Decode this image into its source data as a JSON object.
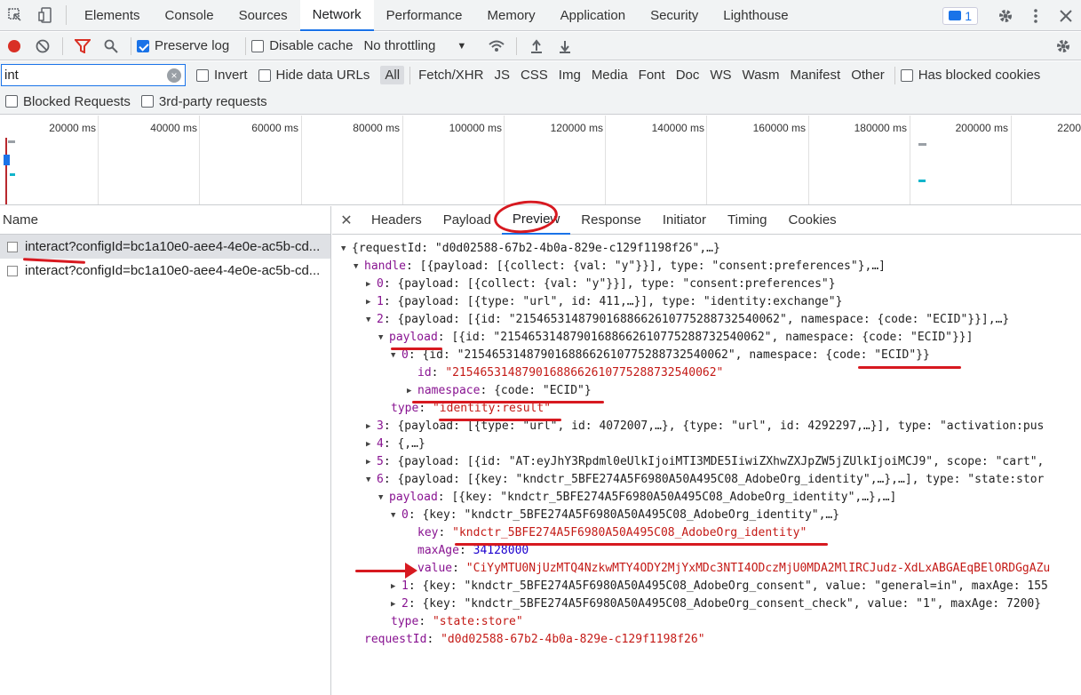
{
  "top_tabs": [
    "Elements",
    "Console",
    "Sources",
    "Network",
    "Performance",
    "Memory",
    "Application",
    "Security",
    "Lighthouse"
  ],
  "active_top_tab": "Network",
  "badge_count": "1",
  "toolbar": {
    "preserve_log": "Preserve log",
    "disable_cache": "Disable cache",
    "throttling": "No throttling"
  },
  "filter": {
    "value": "int",
    "invert": "Invert",
    "hide_data_urls": "Hide data URLs",
    "types": [
      "All",
      "Fetch/XHR",
      "JS",
      "CSS",
      "Img",
      "Media",
      "Font",
      "Doc",
      "WS",
      "Wasm",
      "Manifest",
      "Other"
    ],
    "has_blocked_cookies": "Has blocked cookies",
    "blocked_requests": "Blocked Requests",
    "third_party": "3rd-party requests"
  },
  "timeline": {
    "labels": [
      "20000 ms",
      "40000 ms",
      "60000 ms",
      "80000 ms",
      "100000 ms",
      "120000 ms",
      "140000 ms",
      "160000 ms",
      "180000 ms",
      "200000 ms",
      "2200"
    ]
  },
  "requests": {
    "header": "Name",
    "rows": [
      "interact?configId=bc1a10e0-aee4-4e0e-ac5b-cd...",
      "interact?configId=bc1a10e0-aee4-4e0e-ac5b-cd..."
    ]
  },
  "detail_tabs": [
    "Headers",
    "Payload",
    "Preview",
    "Response",
    "Initiator",
    "Timing",
    "Cookies"
  ],
  "active_detail_tab": "Preview",
  "tree": {
    "l0": "{requestId: \"d0d02588-67b2-4b0a-829e-c129f1198f26\",…}",
    "l1_key": "handle",
    "l1_val": "[{payload: [{collect: {val: \"y\"}}], type: \"consent:preferences\"},…]",
    "l2_0": "{payload: [{collect: {val: \"y\"}}], type: \"consent:preferences\"}",
    "l2_1": "{payload: [{type: \"url\", id: 411,…}], type: \"identity:exchange\"}",
    "l2_2": "{payload: [{id: \"21546531487901688662610775288732540062\", namespace: {code: \"ECID\"}}],…}",
    "l3_payload_val": "[{id: \"21546531487901688662610775288732540062\", namespace: {code: \"ECID\"}}]",
    "l4_0": "{id: \"21546531487901688662610775288732540062\", namespace: {code: \"ECID\"}}",
    "id_val": "\"21546531487901688662610775288732540062\"",
    "namespace_val": "{code: \"ECID\"}",
    "type_val": "\"identity:result\"",
    "l2_3": "{payload: [{type: \"url\", id: 4072007,…}, {type: \"url\", id: 4292297,…}], type: \"activation:pus",
    "l2_4": "{,…}",
    "l2_5": "{payload: [{id: \"AT:eyJhY3Rpdml0eUlkIjoiMTI3MDE5IiwiZXhwZXJpZW5jZUlkIjoiMCJ9\", scope: \"cart\",",
    "l2_6": "{payload: [{key: \"kndctr_5BFE274A5F6980A50A495C08_AdobeOrg_identity\",…},…], type: \"state:stor",
    "l6_payload_val": "[{key: \"kndctr_5BFE274A5F6980A50A495C08_AdobeOrg_identity\",…},…]",
    "l7_0": "{key: \"kndctr_5BFE274A5F6980A50A495C08_AdobeOrg_identity\",…}",
    "key_val": "\"kndctr_5BFE274A5F6980A50A495C08_AdobeOrg_identity\"",
    "maxage_val": "34128000",
    "value_val": "\"CiYyMTU0NjUzMTQ4NzkwMTY4ODY2MjYxMDc3NTI4ODczMjU0MDA2MlIRCJudz-XdLxABGAEqBElORDGgAZu",
    "l7_1": "{key: \"kndctr_5BFE274A5F6980A50A495C08_AdobeOrg_consent\", value: \"general=in\", maxAge: 155",
    "l7_2": "{key: \"kndctr_5BFE274A5F6980A50A495C08_AdobeOrg_consent_check\", value: \"1\", maxAge: 7200}",
    "type2_val": "\"state:store\"",
    "reqid_val": "\"d0d02588-67b2-4b0a-829e-c129f1198f26\""
  },
  "colors": {
    "accent": "#1a73e8",
    "annotation": "#d71920"
  }
}
